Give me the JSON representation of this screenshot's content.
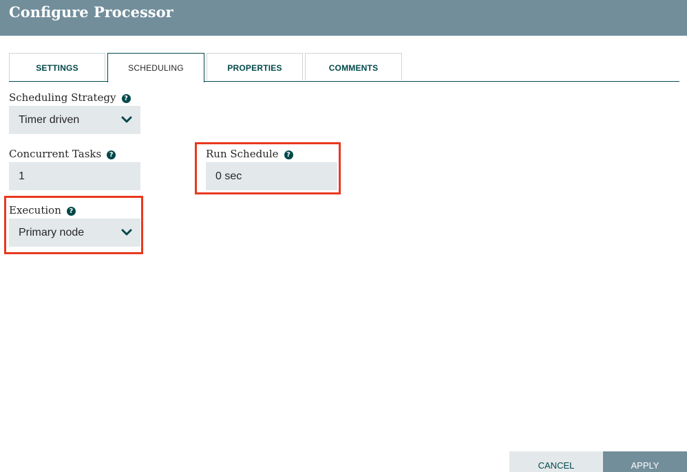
{
  "dialog": {
    "title": "Configure Processor"
  },
  "tabs": [
    {
      "label": "SETTINGS",
      "active": false
    },
    {
      "label": "SCHEDULING",
      "active": true
    },
    {
      "label": "PROPERTIES",
      "active": false
    },
    {
      "label": "COMMENTS",
      "active": false
    }
  ],
  "scheduling": {
    "strategy": {
      "label": "Scheduling Strategy",
      "value": "Timer driven"
    },
    "concurrent_tasks": {
      "label": "Concurrent Tasks",
      "value": "1"
    },
    "run_schedule": {
      "label": "Run Schedule",
      "value": "0 sec"
    },
    "execution": {
      "label": "Execution",
      "value": "Primary node"
    }
  },
  "footer": {
    "cancel_label": "CANCEL",
    "apply_label": "APPLY"
  },
  "colors": {
    "header": "#728e9b",
    "accent": "#004849",
    "input_bg": "#e3e8eb",
    "highlight": "#e8381e"
  },
  "icons": {
    "help": "question-circle-icon",
    "dropdown": "chevron-down-icon"
  }
}
